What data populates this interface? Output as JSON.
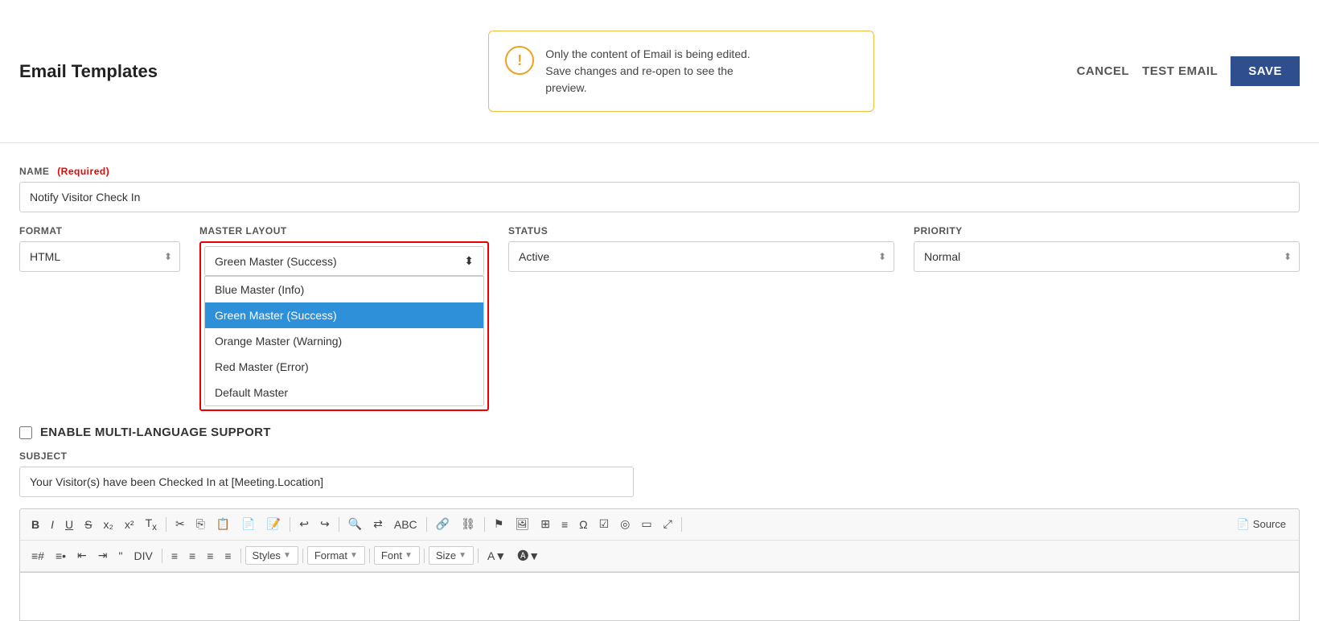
{
  "header": {
    "title": "Email Templates",
    "cancel_label": "CANCEL",
    "test_email_label": "TEST EMAIL",
    "save_label": "SAVE"
  },
  "notification": {
    "message_line1": "Only the content of Email is being edited.",
    "message_line2": "Save changes and re-open to see the",
    "message_line3": "preview."
  },
  "form": {
    "name_label": "NAME",
    "name_required": "(Required)",
    "name_value": "Notify Visitor Check In",
    "format_label": "FORMAT",
    "format_value": "HTML",
    "master_layout_label": "MASTER LAYOUT",
    "master_layout_value": "Green Master (Success)",
    "master_layout_options": [
      "Blue Master (Info)",
      "Green Master (Success)",
      "Orange Master (Warning)",
      "Red Master (Error)",
      "Default Master"
    ],
    "status_label": "STATUS",
    "status_value": "Active",
    "priority_label": "PRIORITY",
    "priority_value": "Normal",
    "enable_multi_language_label": "ENABLE MULTI-LANGUAGE SUPPORT",
    "subject_label": "SUBJECT",
    "subject_value": "Your Visitor(s) have been Checked In at [Meeting.Location]"
  },
  "toolbar": {
    "source_label": "Source",
    "styles_label": "Styles",
    "format_label": "Format",
    "font_label": "Font",
    "size_label": "Size"
  }
}
